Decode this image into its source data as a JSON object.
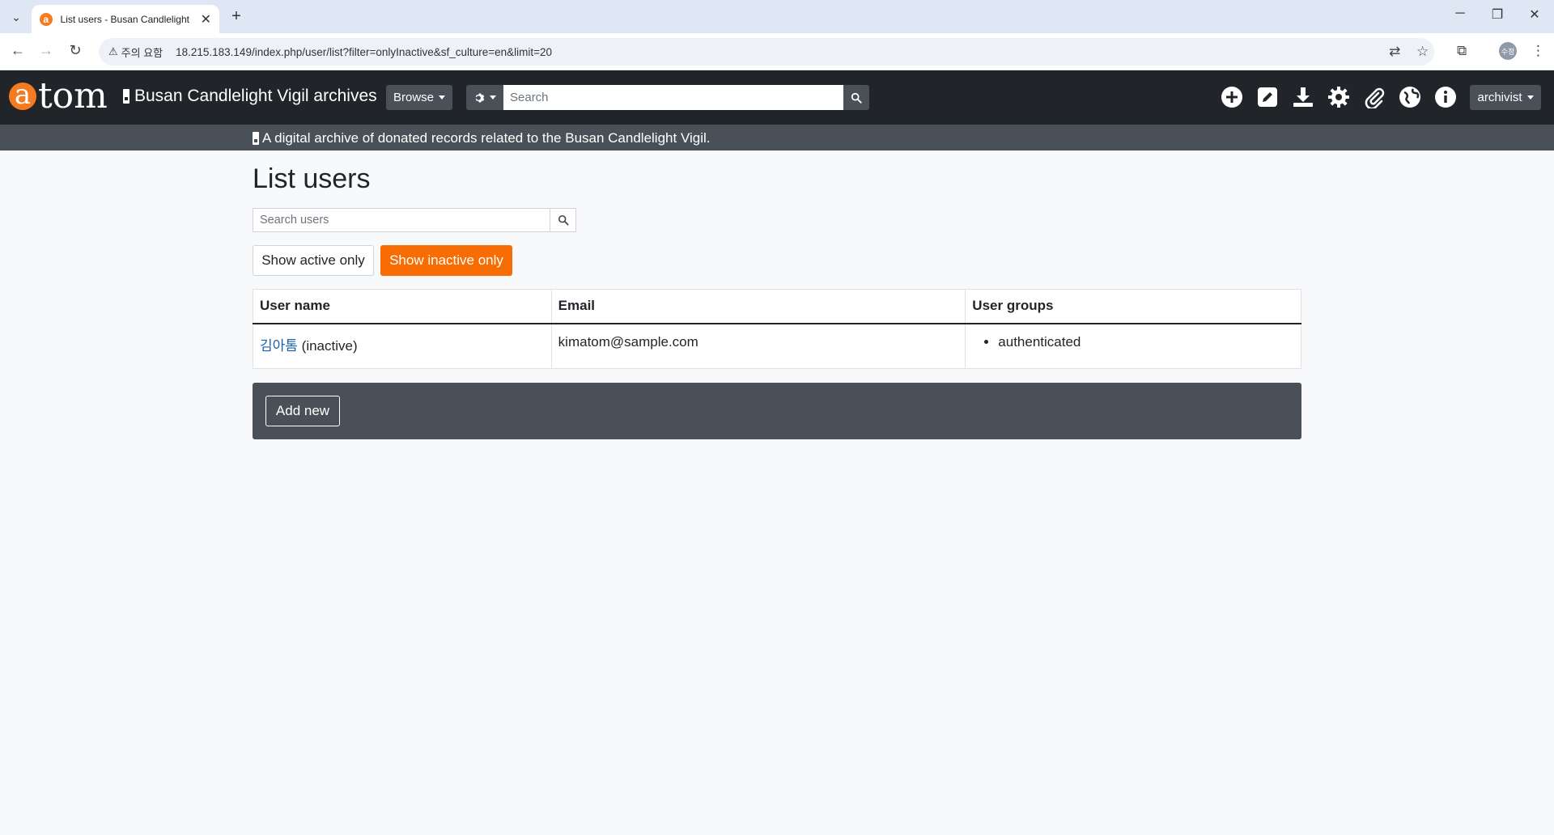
{
  "browser": {
    "tab_title": "List users - Busan Candlelight",
    "tab_favicon": "a",
    "warning_label": "주의 요함",
    "url": "18.215.183.149/index.php/user/list?filter=onlyInactive&sf_culture=en&limit=20",
    "profile_initials": "수정"
  },
  "header": {
    "logo_text": "tom",
    "logo_letter": "a",
    "site_name": "Busan Candlelight Vigil archives",
    "browse_label": "Browse",
    "search_placeholder": "Search",
    "user_menu_label": "archivist",
    "tagline": "A digital archive of donated records related to the Busan Candlelight Vigil.",
    "brand_color": "#f47b20"
  },
  "main": {
    "title": "List users",
    "search_placeholder": "Search users",
    "filter_active_label": "Show active only",
    "filter_inactive_label": "Show inactive only",
    "table": {
      "headers": [
        "User name",
        "Email",
        "User groups"
      ],
      "rows": [
        {
          "username": "김아톰",
          "status": "(inactive)",
          "email": "kimatom@sample.com",
          "groups": [
            "authenticated"
          ]
        }
      ]
    },
    "add_new_label": "Add new",
    "accent_color": "#f76d03"
  }
}
